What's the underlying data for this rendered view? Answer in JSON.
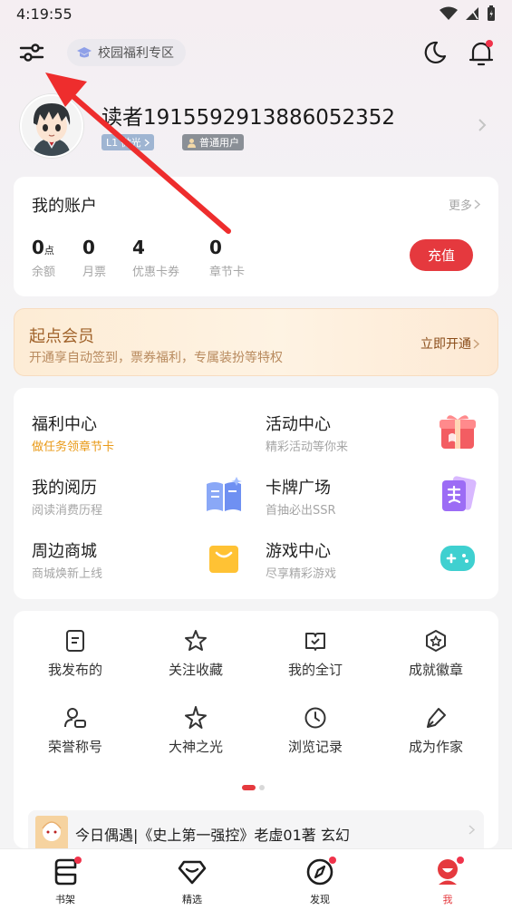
{
  "status_bar": {
    "time": "4:19:55"
  },
  "header": {
    "campus_label": "校园福利专区"
  },
  "profile": {
    "username": "读者1915592913886052352",
    "level": "L1 微光",
    "user_type": "普通用户"
  },
  "account": {
    "title": "我的账户",
    "more": "更多",
    "stats": [
      {
        "value": "0",
        "unit": "点",
        "label": "余额"
      },
      {
        "value": "0",
        "unit": "",
        "label": "月票"
      },
      {
        "value": "4",
        "unit": "",
        "label": "优惠卡券"
      },
      {
        "value": "0",
        "unit": "",
        "label": "章节卡"
      }
    ],
    "recharge": "充值"
  },
  "vip": {
    "title": "起点会员",
    "subtitle": "开通享自动签到，票券福利，专属装扮等特权",
    "action": "立即开通"
  },
  "services": [
    {
      "title": "福利中心",
      "subtitle": "做任务领章节卡",
      "icon": ""
    },
    {
      "title": "活动中心",
      "subtitle": "精彩活动等你来",
      "icon": "gift-icon"
    },
    {
      "title": "我的阅历",
      "subtitle": "阅读消费历程",
      "icon": "book-icon"
    },
    {
      "title": "卡牌广场",
      "subtitle": "首抽必出SSR",
      "icon": "card-icon"
    },
    {
      "title": "周边商城",
      "subtitle": "商城焕新上线",
      "icon": "shopping-bag-icon"
    },
    {
      "title": "游戏中心",
      "subtitle": "尽享精彩游戏",
      "icon": "gamepad-icon"
    }
  ],
  "shortcuts": [
    {
      "label": "我发布的",
      "icon": "document-icon"
    },
    {
      "label": "关注收藏",
      "icon": "star-icon"
    },
    {
      "label": "我的全订",
      "icon": "book-check-icon"
    },
    {
      "label": "成就徽章",
      "icon": "badge-icon"
    },
    {
      "label": "荣誉称号",
      "icon": "person-icon"
    },
    {
      "label": "大神之光",
      "icon": "sparkle-icon"
    },
    {
      "label": "浏览记录",
      "icon": "clock-icon"
    },
    {
      "label": "成为作家",
      "icon": "pen-icon"
    }
  ],
  "encounter": {
    "text": "今日偶遇|《史上第一强控》老虚01著 玄幻"
  },
  "tabs": [
    {
      "label": "书架",
      "icon": "bookshelf-icon",
      "dot": true
    },
    {
      "label": "精选",
      "icon": "diamond-icon",
      "dot": false
    },
    {
      "label": "发现",
      "icon": "compass-icon",
      "dot": true
    },
    {
      "label": "我",
      "icon": "profile-icon",
      "dot": true,
      "active": true
    }
  ],
  "colors": {
    "accent": "#e5393e",
    "vip_text": "#a0622a",
    "highlight": "#e99a18"
  }
}
